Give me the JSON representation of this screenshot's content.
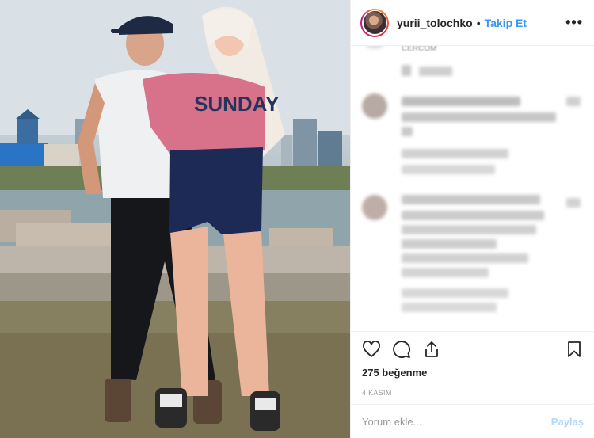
{
  "post": {
    "photo_alt": "",
    "header": {
      "username": "yurii_tolochko",
      "separator": "•",
      "follow_label": "Takip Et",
      "more_label": "•••"
    },
    "comments": {
      "cut_off_text": "CERCOM"
    },
    "actions": {
      "like_icon": "heart-icon",
      "comment_icon": "comment-icon",
      "share_icon": "share-icon",
      "save_icon": "bookmark-icon"
    },
    "likes_text": "275 beğenme",
    "date_text": "4 KASIM",
    "comment_box": {
      "placeholder": "Yorum ekle...",
      "post_label": "Paylaş"
    },
    "shirt_text": "SUNDAY"
  }
}
